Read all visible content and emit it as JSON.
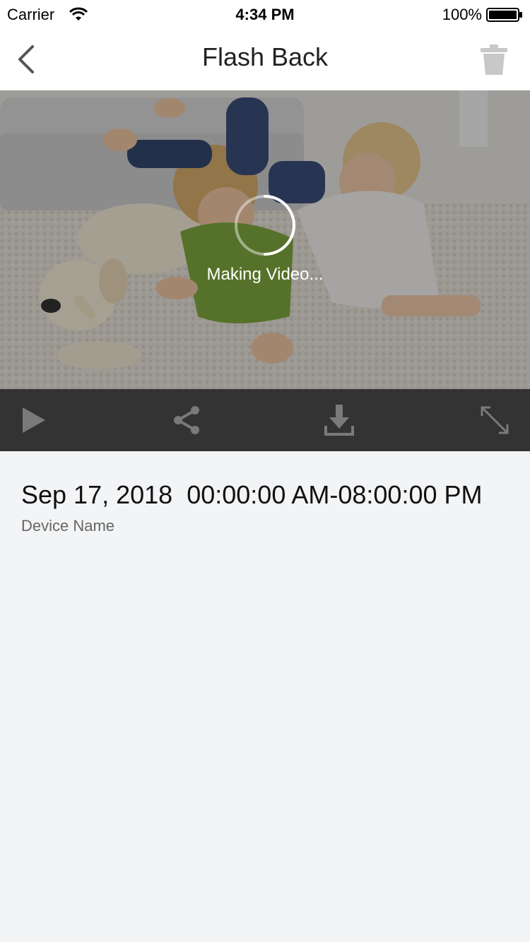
{
  "status_bar": {
    "carrier": "Carrier",
    "time": "4:34 PM",
    "battery": "100%"
  },
  "nav": {
    "title": "Flash Back",
    "back_icon": "chevron-left-icon",
    "trash_icon": "trash-icon"
  },
  "video": {
    "status_text": "Making Video..."
  },
  "controls": {
    "items": [
      "play-icon",
      "share-icon",
      "download-icon",
      "expand-icon"
    ]
  },
  "info": {
    "date": "Sep 17, 2018",
    "time_range": "00:00:00 AM-08:00:00 PM",
    "device_name": "Device Name"
  },
  "colors": {
    "background": "#f3f4f6",
    "controls_bar": "#333333",
    "icon_gray": "#7a7a7a",
    "trash_gray": "#c8c8c8"
  }
}
